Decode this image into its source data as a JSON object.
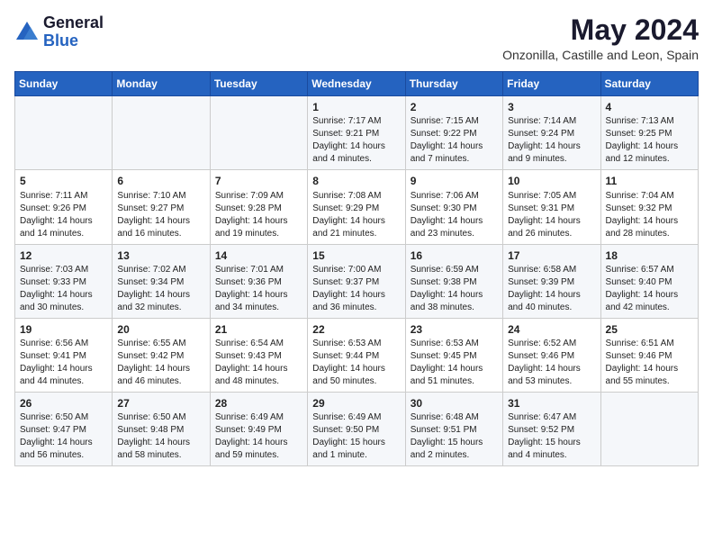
{
  "header": {
    "logo_general": "General",
    "logo_blue": "Blue",
    "month_title": "May 2024",
    "location": "Onzonilla, Castille and Leon, Spain"
  },
  "weekdays": [
    "Sunday",
    "Monday",
    "Tuesday",
    "Wednesday",
    "Thursday",
    "Friday",
    "Saturday"
  ],
  "weeks": [
    [
      {
        "day": "",
        "info": ""
      },
      {
        "day": "",
        "info": ""
      },
      {
        "day": "",
        "info": ""
      },
      {
        "day": "1",
        "info": "Sunrise: 7:17 AM\nSunset: 9:21 PM\nDaylight: 14 hours\nand 4 minutes."
      },
      {
        "day": "2",
        "info": "Sunrise: 7:15 AM\nSunset: 9:22 PM\nDaylight: 14 hours\nand 7 minutes."
      },
      {
        "day": "3",
        "info": "Sunrise: 7:14 AM\nSunset: 9:24 PM\nDaylight: 14 hours\nand 9 minutes."
      },
      {
        "day": "4",
        "info": "Sunrise: 7:13 AM\nSunset: 9:25 PM\nDaylight: 14 hours\nand 12 minutes."
      }
    ],
    [
      {
        "day": "5",
        "info": "Sunrise: 7:11 AM\nSunset: 9:26 PM\nDaylight: 14 hours\nand 14 minutes."
      },
      {
        "day": "6",
        "info": "Sunrise: 7:10 AM\nSunset: 9:27 PM\nDaylight: 14 hours\nand 16 minutes."
      },
      {
        "day": "7",
        "info": "Sunrise: 7:09 AM\nSunset: 9:28 PM\nDaylight: 14 hours\nand 19 minutes."
      },
      {
        "day": "8",
        "info": "Sunrise: 7:08 AM\nSunset: 9:29 PM\nDaylight: 14 hours\nand 21 minutes."
      },
      {
        "day": "9",
        "info": "Sunrise: 7:06 AM\nSunset: 9:30 PM\nDaylight: 14 hours\nand 23 minutes."
      },
      {
        "day": "10",
        "info": "Sunrise: 7:05 AM\nSunset: 9:31 PM\nDaylight: 14 hours\nand 26 minutes."
      },
      {
        "day": "11",
        "info": "Sunrise: 7:04 AM\nSunset: 9:32 PM\nDaylight: 14 hours\nand 28 minutes."
      }
    ],
    [
      {
        "day": "12",
        "info": "Sunrise: 7:03 AM\nSunset: 9:33 PM\nDaylight: 14 hours\nand 30 minutes."
      },
      {
        "day": "13",
        "info": "Sunrise: 7:02 AM\nSunset: 9:34 PM\nDaylight: 14 hours\nand 32 minutes."
      },
      {
        "day": "14",
        "info": "Sunrise: 7:01 AM\nSunset: 9:36 PM\nDaylight: 14 hours\nand 34 minutes."
      },
      {
        "day": "15",
        "info": "Sunrise: 7:00 AM\nSunset: 9:37 PM\nDaylight: 14 hours\nand 36 minutes."
      },
      {
        "day": "16",
        "info": "Sunrise: 6:59 AM\nSunset: 9:38 PM\nDaylight: 14 hours\nand 38 minutes."
      },
      {
        "day": "17",
        "info": "Sunrise: 6:58 AM\nSunset: 9:39 PM\nDaylight: 14 hours\nand 40 minutes."
      },
      {
        "day": "18",
        "info": "Sunrise: 6:57 AM\nSunset: 9:40 PM\nDaylight: 14 hours\nand 42 minutes."
      }
    ],
    [
      {
        "day": "19",
        "info": "Sunrise: 6:56 AM\nSunset: 9:41 PM\nDaylight: 14 hours\nand 44 minutes."
      },
      {
        "day": "20",
        "info": "Sunrise: 6:55 AM\nSunset: 9:42 PM\nDaylight: 14 hours\nand 46 minutes."
      },
      {
        "day": "21",
        "info": "Sunrise: 6:54 AM\nSunset: 9:43 PM\nDaylight: 14 hours\nand 48 minutes."
      },
      {
        "day": "22",
        "info": "Sunrise: 6:53 AM\nSunset: 9:44 PM\nDaylight: 14 hours\nand 50 minutes."
      },
      {
        "day": "23",
        "info": "Sunrise: 6:53 AM\nSunset: 9:45 PM\nDaylight: 14 hours\nand 51 minutes."
      },
      {
        "day": "24",
        "info": "Sunrise: 6:52 AM\nSunset: 9:46 PM\nDaylight: 14 hours\nand 53 minutes."
      },
      {
        "day": "25",
        "info": "Sunrise: 6:51 AM\nSunset: 9:46 PM\nDaylight: 14 hours\nand 55 minutes."
      }
    ],
    [
      {
        "day": "26",
        "info": "Sunrise: 6:50 AM\nSunset: 9:47 PM\nDaylight: 14 hours\nand 56 minutes."
      },
      {
        "day": "27",
        "info": "Sunrise: 6:50 AM\nSunset: 9:48 PM\nDaylight: 14 hours\nand 58 minutes."
      },
      {
        "day": "28",
        "info": "Sunrise: 6:49 AM\nSunset: 9:49 PM\nDaylight: 14 hours\nand 59 minutes."
      },
      {
        "day": "29",
        "info": "Sunrise: 6:49 AM\nSunset: 9:50 PM\nDaylight: 15 hours\nand 1 minute."
      },
      {
        "day": "30",
        "info": "Sunrise: 6:48 AM\nSunset: 9:51 PM\nDaylight: 15 hours\nand 2 minutes."
      },
      {
        "day": "31",
        "info": "Sunrise: 6:47 AM\nSunset: 9:52 PM\nDaylight: 15 hours\nand 4 minutes."
      },
      {
        "day": "",
        "info": ""
      }
    ]
  ]
}
